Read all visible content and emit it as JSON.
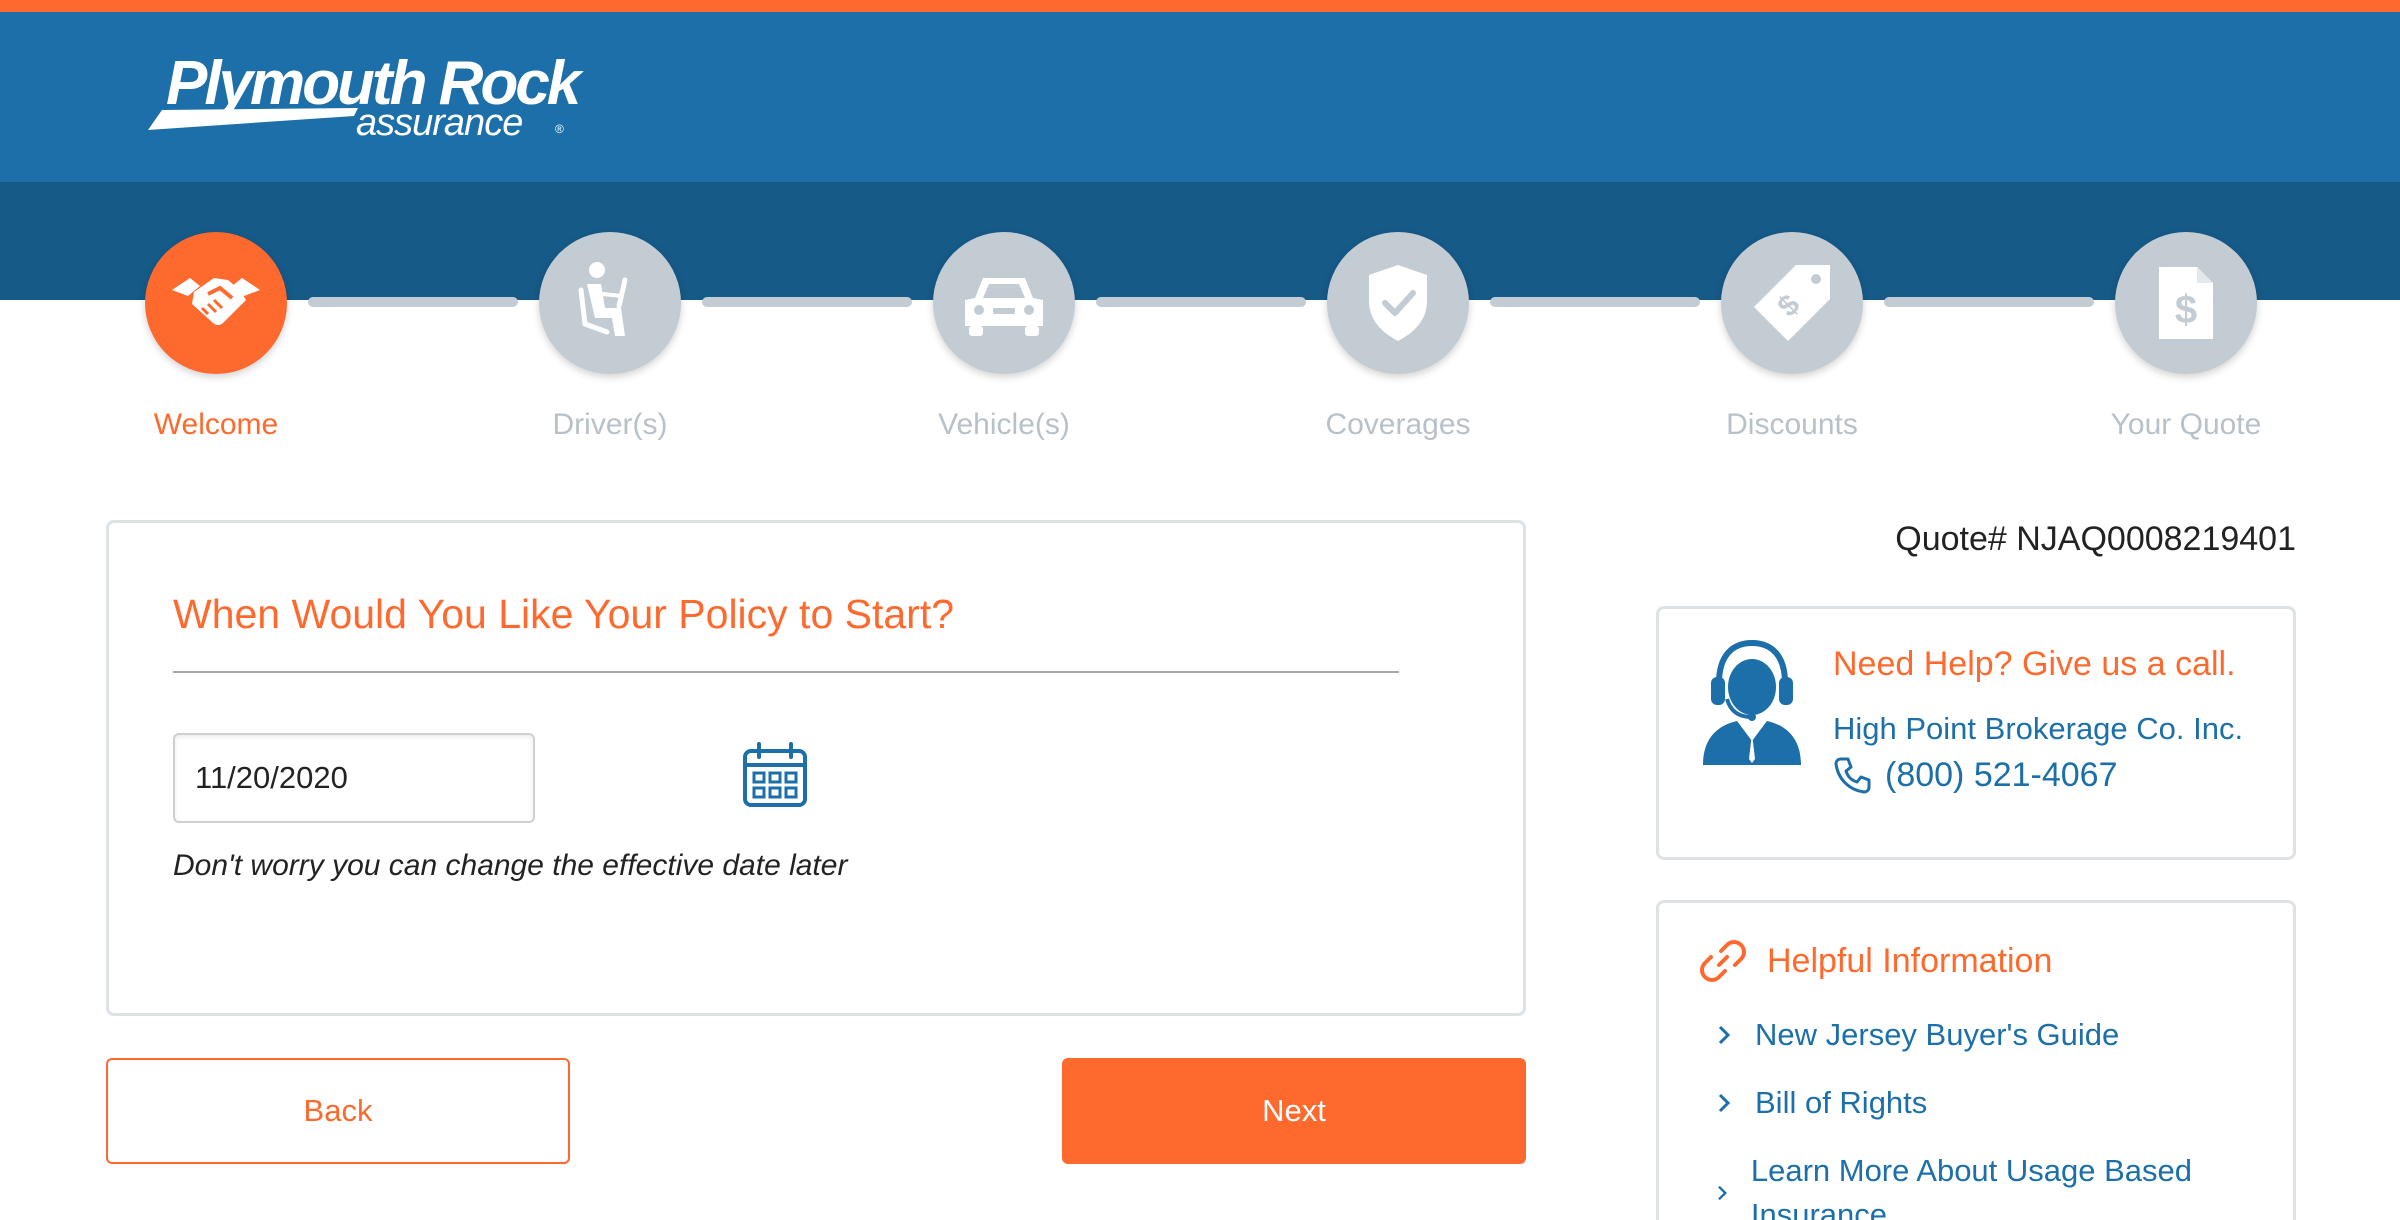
{
  "brand": {
    "name": "Plymouth Rock",
    "sub": "assurance",
    "reg": "®",
    "colors": {
      "orange": "#fe6a2e",
      "blue": "#1c6fa9",
      "dark_blue": "#165a88",
      "step_gray": "#c3ccd3"
    }
  },
  "steps": [
    {
      "label": "Welcome",
      "icon": "handshake-icon",
      "active": true
    },
    {
      "label": "Driver(s)",
      "icon": "driver-seat-icon",
      "active": false
    },
    {
      "label": "Vehicle(s)",
      "icon": "car-icon",
      "active": false
    },
    {
      "label": "Coverages",
      "icon": "shield-check-icon",
      "active": false
    },
    {
      "label": "Discounts",
      "icon": "price-tag-icon",
      "active": false
    },
    {
      "label": "Your Quote",
      "icon": "dollar-document-icon",
      "active": false
    }
  ],
  "form": {
    "title": "When Would You Like Your Policy to Start?",
    "date_value": "11/20/2020",
    "calendar_icon": "calendar-icon",
    "hint": "Don't worry you can change the effective date later",
    "back_label": "Back",
    "next_label": "Next"
  },
  "sidebar": {
    "quote_number": "Quote# NJAQ0008219401",
    "help": {
      "title": "Need Help? Give us a call.",
      "company": "High Point Brokerage Co. Inc.",
      "phone": "(800) 521-4067",
      "agent_icon": "customer-service-agent-icon",
      "phone_icon": "phone-icon"
    },
    "info": {
      "title": "Helpful Information",
      "icon": "link-icon",
      "links": [
        "New Jersey Buyer's Guide",
        "Bill of Rights",
        "Learn More About Usage Based Insurance"
      ]
    }
  }
}
